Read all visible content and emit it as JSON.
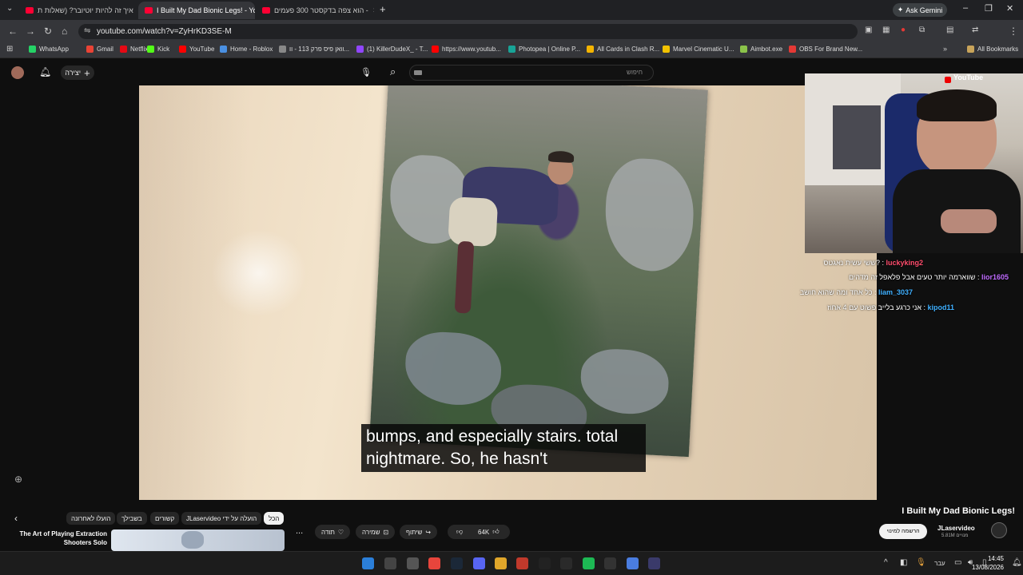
{
  "browser": {
    "tabs": [
      {
        "label": "איך זה להיות יוטיובר? (שאלות ת",
        "active": false
      },
      {
        "label": "I Built My Dad Bionic Legs! - Yo",
        "active": true
      },
      {
        "label": "הוא צפה בדקסטר 300 פעמים -",
        "active": false
      }
    ],
    "ask_gemini": "Ask Gemini",
    "url": "youtube.com/watch?v=ZyHrKD3SE-M",
    "bookmarks": [
      {
        "label": "WhatsApp",
        "color": "#25d366"
      },
      {
        "label": "Gmail",
        "color": "#ea4335"
      },
      {
        "label": "Netflix",
        "color": "#e50914"
      },
      {
        "label": "Kick",
        "color": "#53fc18"
      },
      {
        "label": "YouTube",
        "color": "#ff0000"
      },
      {
        "label": "Home - Roblox",
        "color": "#4a90e2"
      },
      {
        "label": "וואן פיס פרק 113 - וו...",
        "color": "#888888"
      },
      {
        "label": "(1) KillerDudeX_ - T...",
        "color": "#9146ff"
      },
      {
        "label": "https://www.youtub...",
        "color": "#ff0000"
      },
      {
        "label": "Photopea | Online P...",
        "color": "#18a497"
      },
      {
        "label": "All Cards in Clash R...",
        "color": "#f4b400"
      },
      {
        "label": "Marvel Cinematic U...",
        "color": "#f2c200"
      },
      {
        "label": "Aimbot.exe",
        "color": "#8bc34a"
      },
      {
        "label": "OBS For Brand New...",
        "color": "#e53935"
      }
    ],
    "all_bookmarks": "All Bookmarks"
  },
  "youtube": {
    "create_label": "יצירה",
    "search_placeholder": "חיפוש",
    "logo_text": "YouTube"
  },
  "video": {
    "subtitle_line1": "bumps, and especially stairs. total",
    "subtitle_line2": "nightmare. So, he hasn't"
  },
  "chat": [
    {
      "user": "luckyking2",
      "user_color": "#ff4d6d",
      "message": "ששי עשית נאגטס?"
    },
    {
      "user": "lior1605",
      "user_color": "#c06cff",
      "message": "שווארמה יותר טעים אבל פלאפל זה מדהים"
    },
    {
      "user": "liam_3037",
      "user_color": "#3fb0ff",
      "message": "כל אחד ומה שהוא חושב"
    },
    {
      "user": "kipod11",
      "user_color": "#3fb0ff",
      "message": "אני כרגע בלייב פשוט עם 4 אחוז"
    }
  ],
  "chips": [
    "הכל",
    "JLaservideo הועלה על ידי",
    "קשורים",
    "בשבילך",
    "הועלו לאחרונה"
  ],
  "actions": {
    "likes": "64K",
    "share": "שיתוף",
    "save": "שמירה",
    "thanks": "תודה",
    "more": "..."
  },
  "video_info": {
    "title": "I Built My Dad Bionic Legs!",
    "channel": "JLaservideo",
    "subscribers": "5.81M מנויים",
    "subscribe_label": "הרשמה למינוי"
  },
  "next_video": {
    "title": "The Art of Playing Extraction Shooters Solo"
  },
  "taskbar": {
    "time": "14:45",
    "date": "13/08/2026",
    "lang": "עבר"
  }
}
